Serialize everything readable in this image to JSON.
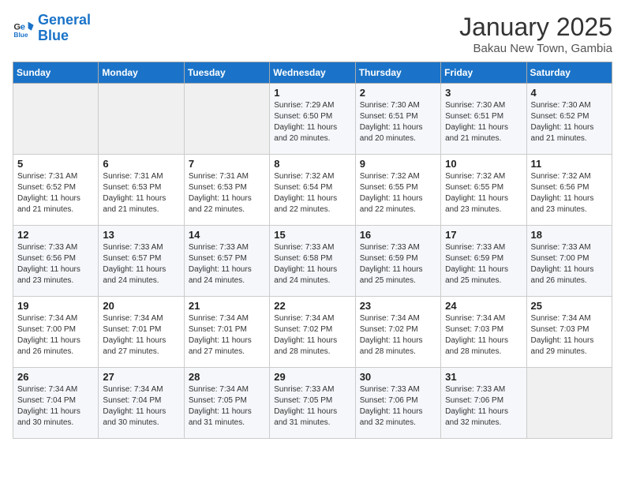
{
  "header": {
    "logo_line1": "General",
    "logo_line2": "Blue",
    "title": "January 2025",
    "subtitle": "Bakau New Town, Gambia"
  },
  "days_of_week": [
    "Sunday",
    "Monday",
    "Tuesday",
    "Wednesday",
    "Thursday",
    "Friday",
    "Saturday"
  ],
  "weeks": [
    [
      {
        "day": "",
        "sunrise": "",
        "sunset": "",
        "daylight": ""
      },
      {
        "day": "",
        "sunrise": "",
        "sunset": "",
        "daylight": ""
      },
      {
        "day": "",
        "sunrise": "",
        "sunset": "",
        "daylight": ""
      },
      {
        "day": "1",
        "sunrise": "Sunrise: 7:29 AM",
        "sunset": "Sunset: 6:50 PM",
        "daylight": "Daylight: 11 hours and 20 minutes."
      },
      {
        "day": "2",
        "sunrise": "Sunrise: 7:30 AM",
        "sunset": "Sunset: 6:51 PM",
        "daylight": "Daylight: 11 hours and 20 minutes."
      },
      {
        "day": "3",
        "sunrise": "Sunrise: 7:30 AM",
        "sunset": "Sunset: 6:51 PM",
        "daylight": "Daylight: 11 hours and 21 minutes."
      },
      {
        "day": "4",
        "sunrise": "Sunrise: 7:30 AM",
        "sunset": "Sunset: 6:52 PM",
        "daylight": "Daylight: 11 hours and 21 minutes."
      }
    ],
    [
      {
        "day": "5",
        "sunrise": "Sunrise: 7:31 AM",
        "sunset": "Sunset: 6:52 PM",
        "daylight": "Daylight: 11 hours and 21 minutes."
      },
      {
        "day": "6",
        "sunrise": "Sunrise: 7:31 AM",
        "sunset": "Sunset: 6:53 PM",
        "daylight": "Daylight: 11 hours and 21 minutes."
      },
      {
        "day": "7",
        "sunrise": "Sunrise: 7:31 AM",
        "sunset": "Sunset: 6:53 PM",
        "daylight": "Daylight: 11 hours and 22 minutes."
      },
      {
        "day": "8",
        "sunrise": "Sunrise: 7:32 AM",
        "sunset": "Sunset: 6:54 PM",
        "daylight": "Daylight: 11 hours and 22 minutes."
      },
      {
        "day": "9",
        "sunrise": "Sunrise: 7:32 AM",
        "sunset": "Sunset: 6:55 PM",
        "daylight": "Daylight: 11 hours and 22 minutes."
      },
      {
        "day": "10",
        "sunrise": "Sunrise: 7:32 AM",
        "sunset": "Sunset: 6:55 PM",
        "daylight": "Daylight: 11 hours and 23 minutes."
      },
      {
        "day": "11",
        "sunrise": "Sunrise: 7:32 AM",
        "sunset": "Sunset: 6:56 PM",
        "daylight": "Daylight: 11 hours and 23 minutes."
      }
    ],
    [
      {
        "day": "12",
        "sunrise": "Sunrise: 7:33 AM",
        "sunset": "Sunset: 6:56 PM",
        "daylight": "Daylight: 11 hours and 23 minutes."
      },
      {
        "day": "13",
        "sunrise": "Sunrise: 7:33 AM",
        "sunset": "Sunset: 6:57 PM",
        "daylight": "Daylight: 11 hours and 24 minutes."
      },
      {
        "day": "14",
        "sunrise": "Sunrise: 7:33 AM",
        "sunset": "Sunset: 6:57 PM",
        "daylight": "Daylight: 11 hours and 24 minutes."
      },
      {
        "day": "15",
        "sunrise": "Sunrise: 7:33 AM",
        "sunset": "Sunset: 6:58 PM",
        "daylight": "Daylight: 11 hours and 24 minutes."
      },
      {
        "day": "16",
        "sunrise": "Sunrise: 7:33 AM",
        "sunset": "Sunset: 6:59 PM",
        "daylight": "Daylight: 11 hours and 25 minutes."
      },
      {
        "day": "17",
        "sunrise": "Sunrise: 7:33 AM",
        "sunset": "Sunset: 6:59 PM",
        "daylight": "Daylight: 11 hours and 25 minutes."
      },
      {
        "day": "18",
        "sunrise": "Sunrise: 7:33 AM",
        "sunset": "Sunset: 7:00 PM",
        "daylight": "Daylight: 11 hours and 26 minutes."
      }
    ],
    [
      {
        "day": "19",
        "sunrise": "Sunrise: 7:34 AM",
        "sunset": "Sunset: 7:00 PM",
        "daylight": "Daylight: 11 hours and 26 minutes."
      },
      {
        "day": "20",
        "sunrise": "Sunrise: 7:34 AM",
        "sunset": "Sunset: 7:01 PM",
        "daylight": "Daylight: 11 hours and 27 minutes."
      },
      {
        "day": "21",
        "sunrise": "Sunrise: 7:34 AM",
        "sunset": "Sunset: 7:01 PM",
        "daylight": "Daylight: 11 hours and 27 minutes."
      },
      {
        "day": "22",
        "sunrise": "Sunrise: 7:34 AM",
        "sunset": "Sunset: 7:02 PM",
        "daylight": "Daylight: 11 hours and 28 minutes."
      },
      {
        "day": "23",
        "sunrise": "Sunrise: 7:34 AM",
        "sunset": "Sunset: 7:02 PM",
        "daylight": "Daylight: 11 hours and 28 minutes."
      },
      {
        "day": "24",
        "sunrise": "Sunrise: 7:34 AM",
        "sunset": "Sunset: 7:03 PM",
        "daylight": "Daylight: 11 hours and 28 minutes."
      },
      {
        "day": "25",
        "sunrise": "Sunrise: 7:34 AM",
        "sunset": "Sunset: 7:03 PM",
        "daylight": "Daylight: 11 hours and 29 minutes."
      }
    ],
    [
      {
        "day": "26",
        "sunrise": "Sunrise: 7:34 AM",
        "sunset": "Sunset: 7:04 PM",
        "daylight": "Daylight: 11 hours and 30 minutes."
      },
      {
        "day": "27",
        "sunrise": "Sunrise: 7:34 AM",
        "sunset": "Sunset: 7:04 PM",
        "daylight": "Daylight: 11 hours and 30 minutes."
      },
      {
        "day": "28",
        "sunrise": "Sunrise: 7:34 AM",
        "sunset": "Sunset: 7:05 PM",
        "daylight": "Daylight: 11 hours and 31 minutes."
      },
      {
        "day": "29",
        "sunrise": "Sunrise: 7:33 AM",
        "sunset": "Sunset: 7:05 PM",
        "daylight": "Daylight: 11 hours and 31 minutes."
      },
      {
        "day": "30",
        "sunrise": "Sunrise: 7:33 AM",
        "sunset": "Sunset: 7:06 PM",
        "daylight": "Daylight: 11 hours and 32 minutes."
      },
      {
        "day": "31",
        "sunrise": "Sunrise: 7:33 AM",
        "sunset": "Sunset: 7:06 PM",
        "daylight": "Daylight: 11 hours and 32 minutes."
      },
      {
        "day": "",
        "sunrise": "",
        "sunset": "",
        "daylight": ""
      }
    ]
  ]
}
